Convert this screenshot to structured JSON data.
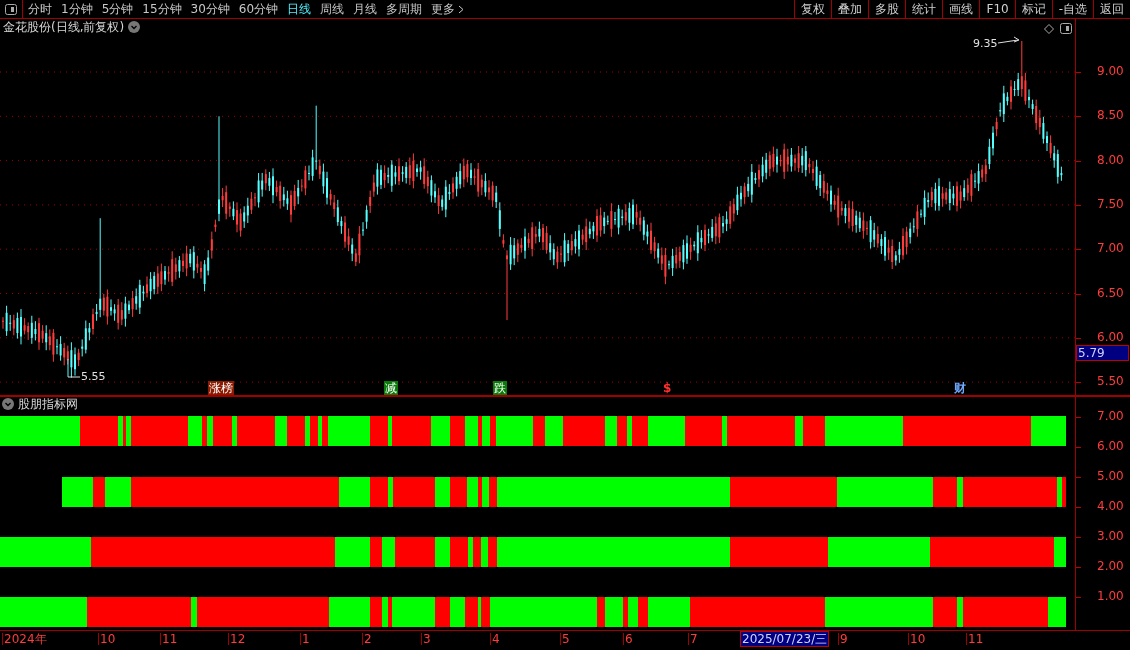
{
  "toolbar": {
    "periods": [
      {
        "label": "分时",
        "selected": false
      },
      {
        "label": "1分钟",
        "selected": false
      },
      {
        "label": "5分钟",
        "selected": false
      },
      {
        "label": "15分钟",
        "selected": false
      },
      {
        "label": "30分钟",
        "selected": false
      },
      {
        "label": "60分钟",
        "selected": false
      },
      {
        "label": "日线",
        "selected": true
      },
      {
        "label": "周线",
        "selected": false
      },
      {
        "label": "月线",
        "selected": false
      },
      {
        "label": "多周期",
        "selected": false
      },
      {
        "label": "更多",
        "selected": false
      }
    ],
    "buttons": [
      "复权",
      "叠加",
      "多股",
      "统计",
      "画线",
      "F10",
      "标记",
      "-自选",
      "返回"
    ]
  },
  "price_chart": {
    "title": "金花股份(日线,前复权)",
    "high_marker": "9.35",
    "low_marker": "5.55",
    "current_price": "5.79",
    "y_labels": [
      "9.00",
      "8.50",
      "8.00",
      "7.50",
      "7.00",
      "6.50",
      "6.00",
      "5.50"
    ],
    "event_tags": [
      {
        "label": "涨榜",
        "kind": "badge",
        "color": "#8b1a00"
      },
      {
        "label": "减",
        "kind": "badge",
        "color": "#0a7a0a"
      },
      {
        "label": "跌",
        "kind": "badge",
        "color": "#0a7a0a"
      },
      {
        "label": "$",
        "kind": "text",
        "color": "#ff3030"
      },
      {
        "label": "财",
        "kind": "text",
        "color": "#6fa8ff"
      }
    ]
  },
  "indicator": {
    "title": "股朋指标网",
    "y_labels": [
      "7.00",
      "6.00",
      "5.00",
      "4.00",
      "3.00",
      "2.00",
      "1.00"
    ]
  },
  "date_axis": {
    "labels": [
      "2024年",
      "10",
      "11",
      "12",
      "1",
      "2",
      "3",
      "4",
      "5",
      "6",
      "7",
      "9",
      "10",
      "11"
    ],
    "cursor_date": "2025/07/23/三"
  }
}
